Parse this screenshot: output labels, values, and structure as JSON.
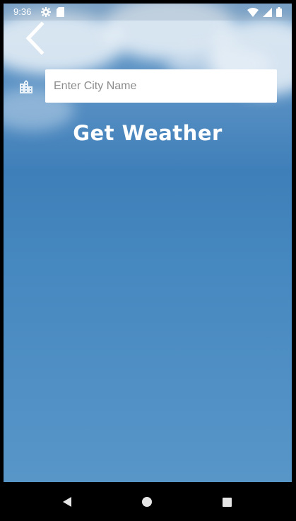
{
  "status_bar": {
    "time": "9:36",
    "left_icons": [
      "settings-icon",
      "sd-card-icon"
    ],
    "right_icons": [
      "wifi-icon",
      "cell-signal-icon",
      "battery-icon"
    ]
  },
  "header": {
    "back_icon": "chevron-left-icon"
  },
  "search": {
    "icon": "city-icon",
    "placeholder": "Enter City Name",
    "value": ""
  },
  "actions": {
    "get_weather_label": "Get Weather"
  },
  "nav_bar": {
    "buttons": [
      "back-triangle-icon",
      "home-circle-icon",
      "recents-square-icon"
    ]
  },
  "colors": {
    "sky_top": "#6a9cc9",
    "sky_mid": "#3f7fb9",
    "sky_bottom": "#5896c8",
    "text": "#ffffff"
  }
}
